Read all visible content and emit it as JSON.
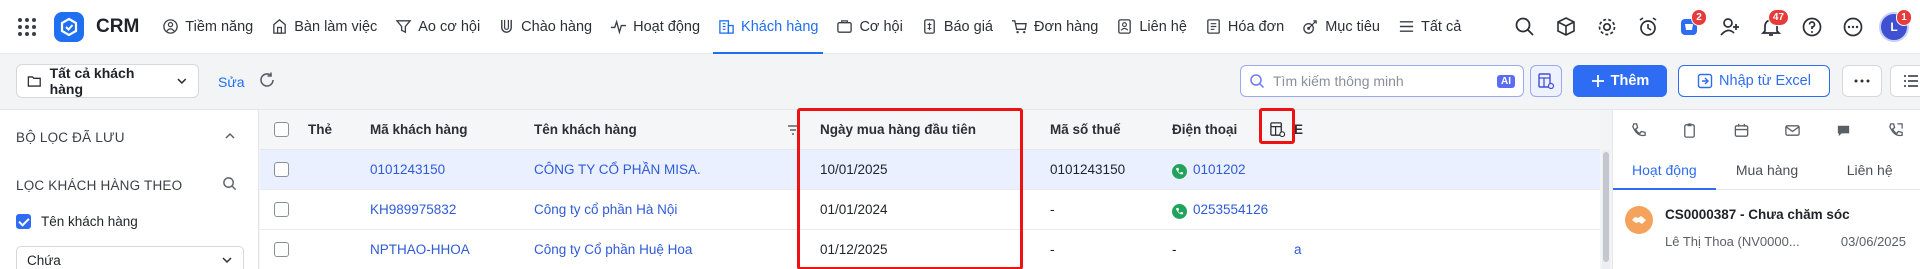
{
  "app": {
    "name": "CRM"
  },
  "nav": [
    {
      "label": "Tiềm năng",
      "icon": "target-icon"
    },
    {
      "label": "Bàn làm việc",
      "icon": "desk-icon"
    },
    {
      "label": "Ao cơ hội",
      "icon": "funnel-icon"
    },
    {
      "label": "Chào hàng",
      "icon": "magnet-icon"
    },
    {
      "label": "Hoạt động",
      "icon": "activity-icon"
    },
    {
      "label": "Khách hàng",
      "icon": "building-icon",
      "active": true
    },
    {
      "label": "Cơ hội",
      "icon": "briefcase-icon"
    },
    {
      "label": "Báo giá",
      "icon": "quote-icon"
    },
    {
      "label": "Đơn hàng",
      "icon": "cart-icon"
    },
    {
      "label": "Liên hệ",
      "icon": "contact-icon"
    },
    {
      "label": "Hóa đơn",
      "icon": "invoice-icon"
    },
    {
      "label": "Mục tiêu",
      "icon": "goal-icon"
    },
    {
      "label": "Tất cả",
      "icon": "menu-icon"
    }
  ],
  "topright": {
    "cart_badge": "2",
    "notification_badge": "47",
    "avatar_initial": "L",
    "avatar_badge": "1"
  },
  "toolbar": {
    "view_label": "Tất cả khách hàng",
    "edit_label": "Sửa",
    "search_placeholder": "Tìm kiếm thông minh",
    "search_ai_badge": "AI",
    "add_label": "Thêm",
    "import_label": "Nhập từ Excel"
  },
  "filters": {
    "saved_header": "BỘ LỌC ĐÃ LƯU",
    "by_header": "LỌC KHÁCH HÀNG THEO",
    "option_label": "Tên khách hàng",
    "condition_value": "Chứa"
  },
  "table": {
    "columns": [
      "Thẻ",
      "Mã khách hàng",
      "Tên khách hàng",
      "Ngày mua hàng đầu tiên",
      "Mã số thuế",
      "Điện thoại",
      "E"
    ],
    "rows": [
      {
        "tag": "",
        "code": "0101243150",
        "name": "CÔNG TY CỔ PHẦN MISA.",
        "first_purchase": "10/01/2025",
        "tax_code": "0101243150",
        "phone": "0101202",
        "selected": true
      },
      {
        "tag": "",
        "code": "KH989975832",
        "name": "Công ty cổ phần Hà Nội",
        "first_purchase": "01/01/2024",
        "tax_code": "-",
        "phone": "0253554126",
        "selected": false
      },
      {
        "tag": "",
        "code": "NPTHAO-HHOA",
        "name": "Công ty Cổ phần Huệ Hoa",
        "first_purchase": "01/12/2025",
        "tax_code": "-",
        "phone": "-",
        "selected": false
      }
    ],
    "row_trailing": [
      "",
      "",
      "a"
    ]
  },
  "right_panel": {
    "tabs": [
      "Hoạt động",
      "Mua hàng",
      "Liên hệ"
    ],
    "activity": {
      "title": "CS0000387 - Chưa chăm sóc",
      "owner": "Lê Thị Thoa (NV0000...",
      "date": "03/06/2025"
    }
  },
  "colors": {
    "accent": "#1e6ff2",
    "highlight_box": "#ee1111",
    "selected_row": "#eaf0ff",
    "phone_green": "#21a35c"
  }
}
